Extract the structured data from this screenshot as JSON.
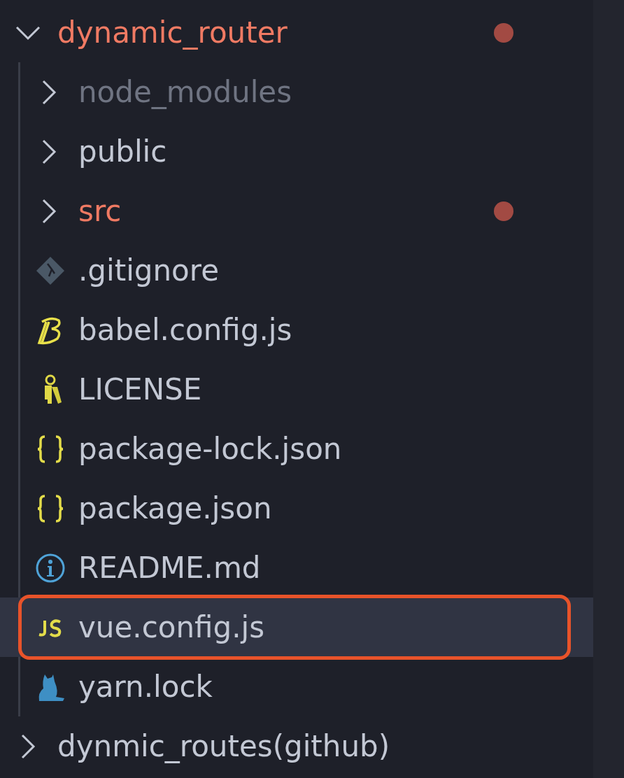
{
  "explorer": {
    "items": [
      {
        "name": "dynamic_router",
        "kind": "folder",
        "expanded": true,
        "modified": true,
        "ignored": false,
        "selected": false,
        "outlined": false,
        "children": [
          {
            "name": "node_modules",
            "kind": "folder",
            "expanded": false,
            "modified": false,
            "ignored": true,
            "selected": false,
            "outlined": false
          },
          {
            "name": "public",
            "kind": "folder",
            "expanded": false,
            "modified": false,
            "ignored": false,
            "selected": false,
            "outlined": false
          },
          {
            "name": "src",
            "kind": "folder",
            "expanded": false,
            "modified": true,
            "ignored": false,
            "selected": false,
            "outlined": false
          },
          {
            "name": ".gitignore",
            "kind": "git",
            "modified": false,
            "ignored": false,
            "selected": false,
            "outlined": false
          },
          {
            "name": "babel.config.js",
            "kind": "babel",
            "modified": false,
            "ignored": false,
            "selected": false,
            "outlined": false
          },
          {
            "name": "LICENSE",
            "kind": "license",
            "modified": false,
            "ignored": false,
            "selected": false,
            "outlined": false
          },
          {
            "name": "package-lock.json",
            "kind": "json",
            "modified": false,
            "ignored": false,
            "selected": false,
            "outlined": false
          },
          {
            "name": "package.json",
            "kind": "json",
            "modified": false,
            "ignored": false,
            "selected": false,
            "outlined": false
          },
          {
            "name": "README.md",
            "kind": "info",
            "modified": false,
            "ignored": false,
            "selected": false,
            "outlined": false
          },
          {
            "name": "vue.config.js",
            "kind": "js",
            "modified": false,
            "ignored": false,
            "selected": true,
            "outlined": true
          },
          {
            "name": "yarn.lock",
            "kind": "yarn",
            "modified": false,
            "ignored": false,
            "selected": false,
            "outlined": false
          }
        ]
      },
      {
        "name": "dynmic_routes(github)",
        "kind": "folder",
        "expanded": false,
        "modified": false,
        "ignored": false,
        "selected": false,
        "outlined": false
      }
    ]
  }
}
